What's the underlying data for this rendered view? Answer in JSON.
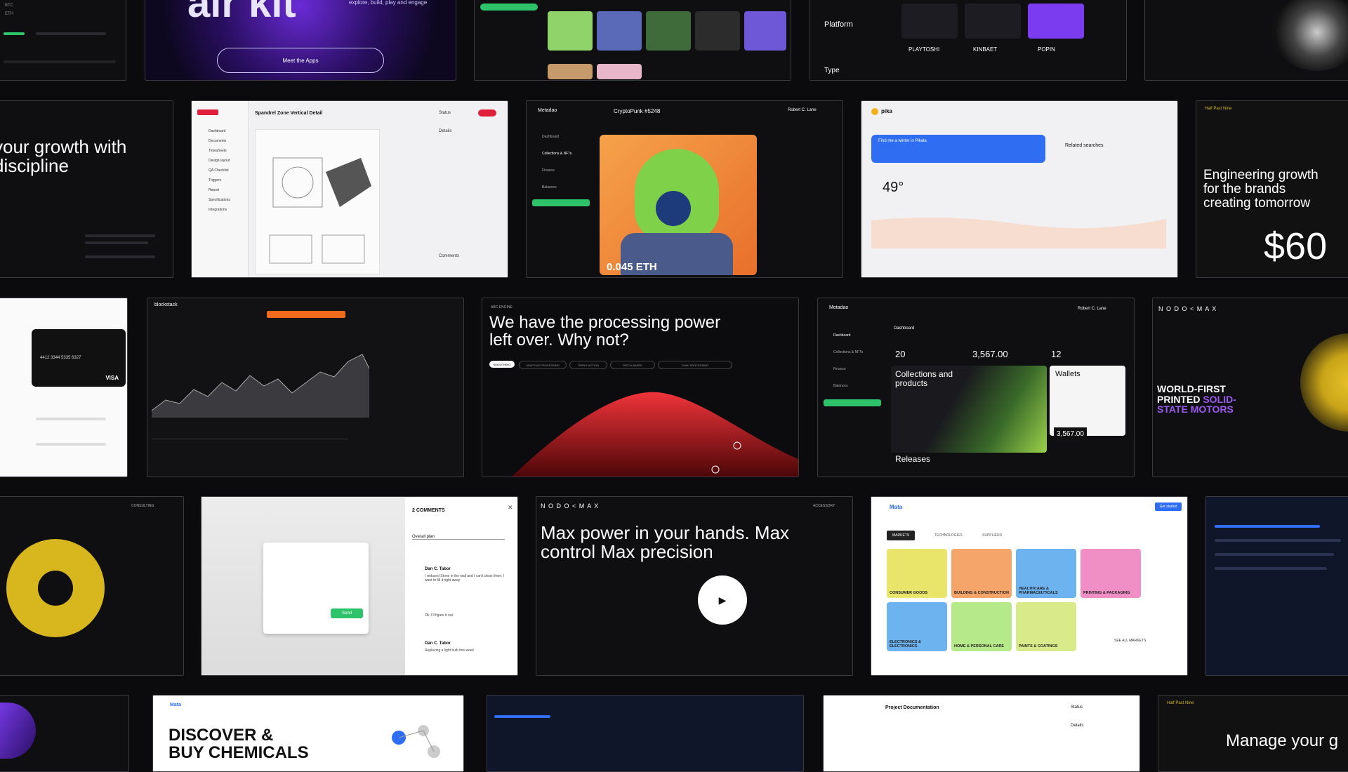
{
  "tiles": {
    "airkit": {
      "title": "air kit",
      "tagline": "explore, build, play and engage",
      "cta": "Meet the Apps"
    },
    "platform": {
      "title": "Platform",
      "type_label": "Type",
      "brands": [
        "PLAYTOSHI",
        "KINBAET",
        "POPIN"
      ]
    },
    "growth_left": {
      "headline": "your growth with discipline"
    },
    "spandrel": {
      "title": "Spandrel Zone Vertical Detail",
      "status_label": "Status",
      "details_label": "Details",
      "comments_label": "Comments",
      "nav": [
        "Dashboard",
        "Documents",
        "Timesheets",
        "Design layout",
        "QA Checklist",
        "Triggers",
        "Report",
        "Specifications",
        "Integrations"
      ]
    },
    "cryptopunk": {
      "brand": "Metadao",
      "title": "CryptoPunk #5248",
      "price": "0.045 ETH",
      "user": "Robert C. Lane",
      "nav": [
        "Dashboard",
        "Collections & NFTs",
        "Finance",
        "Balances"
      ]
    },
    "pika": {
      "brand": "pika",
      "search_prompt": "Find me a winter in Pikala",
      "related": "Related searches",
      "temperature": "49",
      "temp_unit": "°"
    },
    "engineering": {
      "brand": "Half Past Nine",
      "headline": "Engineering growth for the brands creating tomorrow",
      "price": "$60"
    },
    "card": {
      "number": "4412 3344 5335 6327",
      "network": "VISA"
    },
    "blockstack": {
      "brand": "blockstack"
    },
    "processing": {
      "label": "ABC ENGINE",
      "headline": "We have the processing power left over. Why not?",
      "tags": [
        "SMOOTHING",
        "ADAPTIVE PROCESSING",
        "TRIPLE ACTION",
        "PATCH-BASED",
        "DUAL PROCESSING"
      ]
    },
    "metadao_dash": {
      "brand": "Metadao",
      "page": "Dashboard",
      "stat1": "20",
      "stat2": "3,567.00",
      "stat3": "12",
      "collections": "Collections and products",
      "wallets": "Wallets",
      "wallet_value": "3,567.00",
      "releases": "Releases",
      "nav": [
        "Dashboard",
        "Collections & NFTs",
        "Finance",
        "Balances"
      ],
      "user": "Robert C. Lane"
    },
    "nodemax_motors": {
      "brand": "N O D O < M A X",
      "headline1": "WORLD-FIRST PRINTED ",
      "headline2": "SOLID-STATE MOTORS"
    },
    "yellow_disc": {
      "label": "CONSULTING"
    },
    "comments": {
      "title": "2 COMMENTS",
      "select": "Overall plan",
      "commenter1": "Dan C. Tabor",
      "commenter2": "Dan C. Tabor",
      "send": "Send",
      "comment1": "I reduced Stone in the wall and I can't clean them. I want to fill it right away",
      "comment2": "Ok, I'll figure it out.",
      "comment3": "Replacing a light bulb this week"
    },
    "maxpower": {
      "brand": "N O D O < M A X",
      "headline": "Max power in your hands. Max control Max precision",
      "corner": "ACCESSORY"
    },
    "mata": {
      "brand": "Mata",
      "tabs": [
        "MARKETS",
        "TECHNOLOGIES",
        "SUPPLIERS"
      ],
      "categories": [
        "CONSUMER GOODS",
        "BUILDING & CONSTRUCTION",
        "HEALTHCARE & PHARMACEUTICALS",
        "PRINTING & PACKAGING",
        "ELECTRONICS & ELECTRONICS",
        "HOME & PERSONAL CARE",
        "PAINTS & COATINGS"
      ],
      "all_markets": "SEE ALL MARKETS",
      "cta": "Get started"
    },
    "chemicals": {
      "brand": "Mata",
      "headline": "DISCOVER & BUY CHEMICALS"
    },
    "project_doc": {
      "title": "Project Documentation",
      "status": "Status",
      "details": "Details"
    },
    "manage": {
      "brand": "Half Past Nine",
      "headline": "Manage your g"
    }
  },
  "colors": {
    "accent_green": "#2ec26a",
    "accent_blue": "#2f6ef2",
    "accent_red": "#e0203a",
    "accent_yellow": "#d8b61e",
    "accent_purple": "#7b3cf0"
  }
}
